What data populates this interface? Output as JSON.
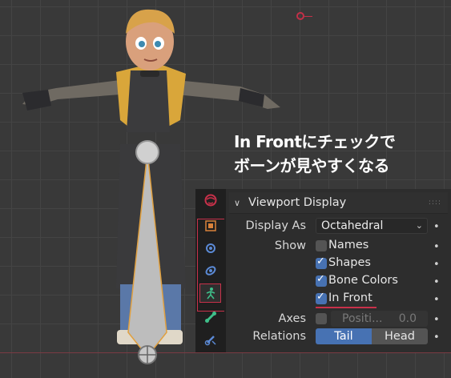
{
  "caption": {
    "line1": "In Frontにチェックで",
    "line2": "ボーンが見やすくなる"
  },
  "tabs": [
    {
      "icon": "world-icon"
    },
    {
      "icon": "object-icon"
    },
    {
      "icon": "modifier-icon"
    },
    {
      "icon": "physics-icon"
    },
    {
      "icon": "armature-data-icon",
      "active": true
    },
    {
      "icon": "bone-icon"
    },
    {
      "icon": "bone-constraint-icon"
    }
  ],
  "panel": {
    "title": "Viewport Display",
    "display_as": {
      "label": "Display As",
      "value": "Octahedral"
    },
    "show": {
      "label": "Show",
      "names": {
        "label": "Names",
        "checked": false
      },
      "shapes": {
        "label": "Shapes",
        "checked": true
      },
      "bone_colors": {
        "label": "Bone Colors",
        "checked": true
      },
      "in_front": {
        "label": "In Front",
        "checked": true
      }
    },
    "axes": {
      "label": "Axes",
      "position_label": "Positi...",
      "position_value": "0.0"
    },
    "relations": {
      "label": "Relations",
      "tail": "Tail",
      "head": "Head",
      "selected": "Tail"
    },
    "keyframe_dot": "•"
  },
  "colors": {
    "accent": "#4772b3",
    "highlight": "#c8314a",
    "bone": "#c0c0c0"
  }
}
